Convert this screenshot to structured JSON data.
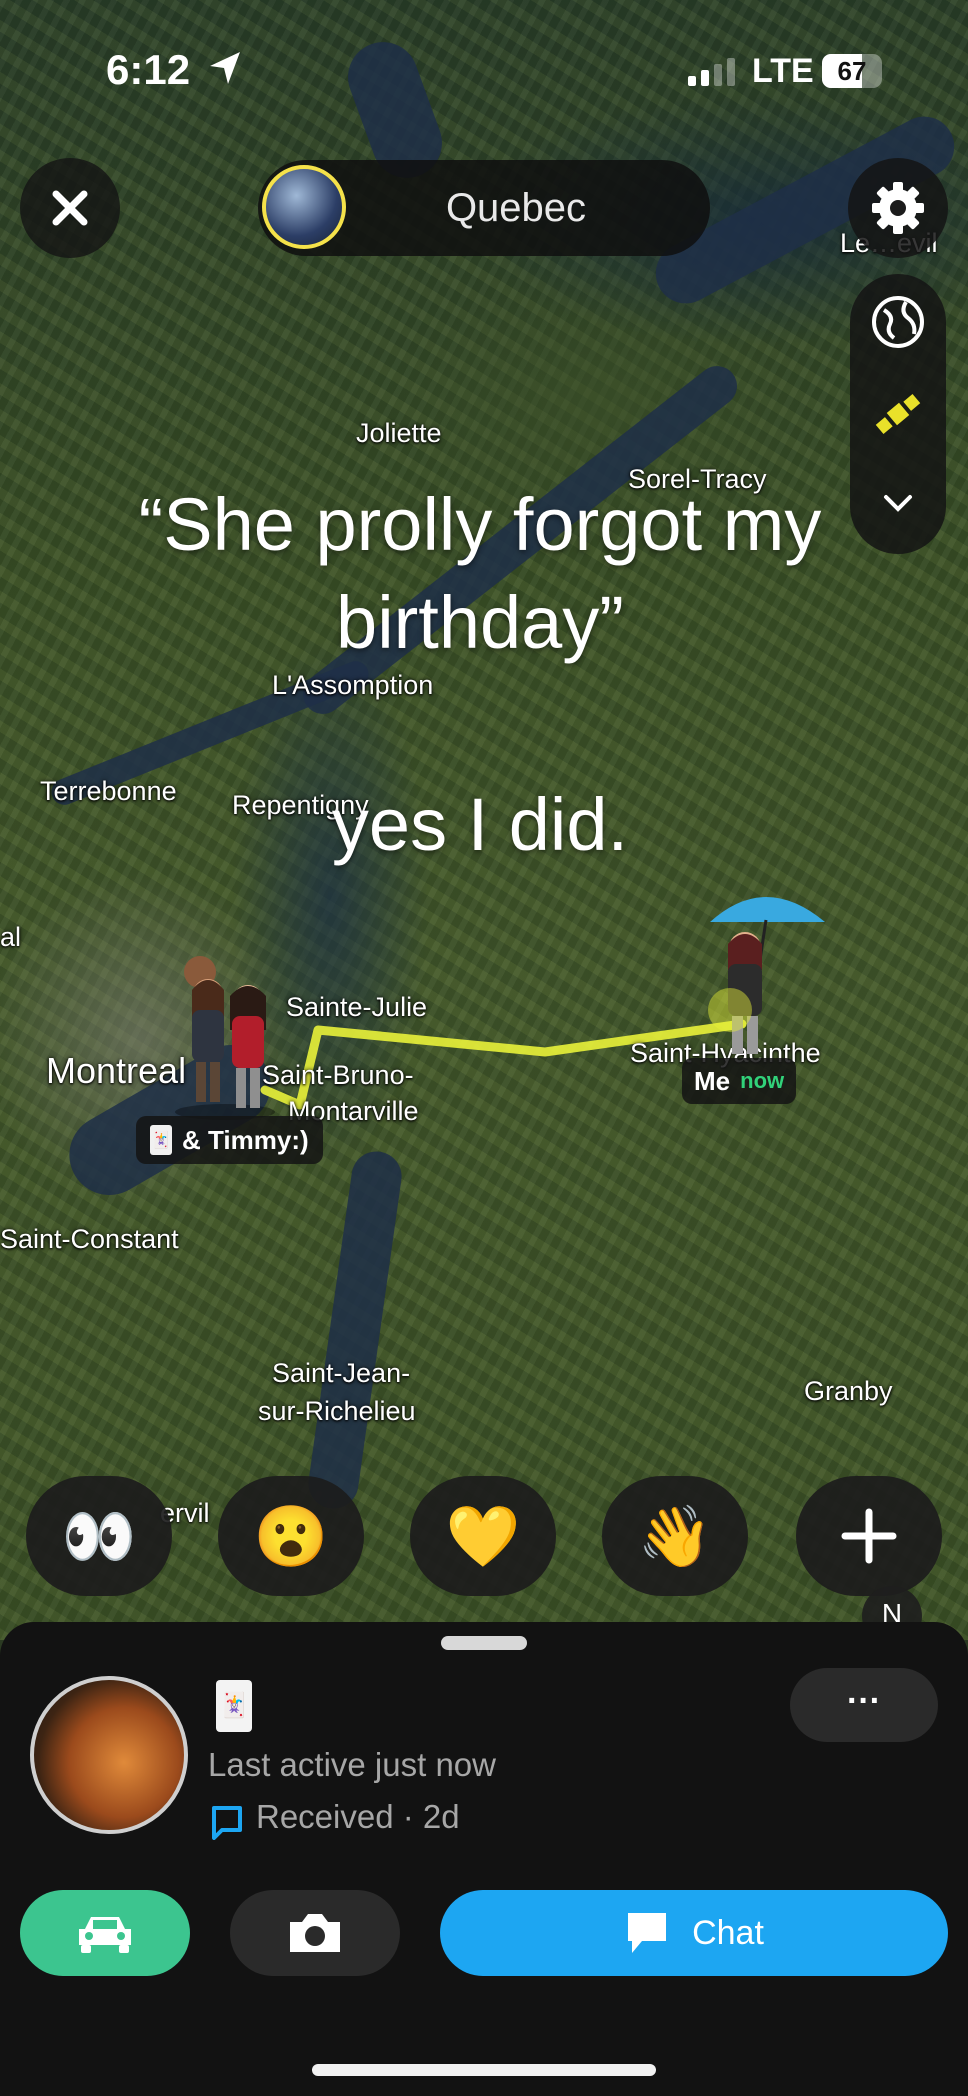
{
  "status_bar": {
    "time": "6:12",
    "network": "LTE",
    "battery": "67",
    "battery_level": 67
  },
  "header": {
    "title": "Quebec",
    "close_icon": "close-icon",
    "settings_icon": "gear-icon"
  },
  "side_controls": {
    "globe_icon": "globe-icon",
    "satellite_icon": "satellite-icon",
    "expand_icon": "chevron-down-icon"
  },
  "caption": {
    "line1": "“She prolly forgot my birthday”",
    "line2": "yes I did."
  },
  "map": {
    "places": [
      {
        "name": "Le…evil"
      },
      {
        "name": "Joliette"
      },
      {
        "name": "Sorel-Tracy"
      },
      {
        "name": "L'Assomption"
      },
      {
        "name": "Terrebonne"
      },
      {
        "name": "Repentigny"
      },
      {
        "name": "al"
      },
      {
        "name": "Sainte-Julie"
      },
      {
        "name": "Montreal"
      },
      {
        "name": "Saint-Bruno-"
      },
      {
        "name": "Montarville"
      },
      {
        "name": "Saint-Hyacinthe"
      },
      {
        "name": "Saint-Constant"
      },
      {
        "name": "Saint-Jean-"
      },
      {
        "name": "sur-Richelieu"
      },
      {
        "name": "Granby"
      },
      {
        "name": "ervil"
      }
    ],
    "friend_tag": "& Timmy:)",
    "me_tag": {
      "label": "Me",
      "status": "now"
    },
    "route_color": "#e9f23a"
  },
  "reactions": [
    {
      "emoji": "👀",
      "name": "eyes"
    },
    {
      "emoji": "😮",
      "name": "surprised"
    },
    {
      "emoji": "💛",
      "name": "yellow-heart"
    },
    {
      "emoji": "👋",
      "name": "wave"
    }
  ],
  "compass": "N",
  "profile": {
    "card_glyph": "🃏",
    "last_active": "Last active just now",
    "received": "Received · 2d",
    "more_label": "···"
  },
  "actions": {
    "chat_label": "Chat",
    "car_icon": "car-icon",
    "camera_icon": "camera-icon",
    "chat_icon": "chat-bubble-icon"
  },
  "colors": {
    "accent_blue": "#1da6f2",
    "accent_green": "#3cc58f",
    "avatar_ring": "#f5e24a"
  }
}
